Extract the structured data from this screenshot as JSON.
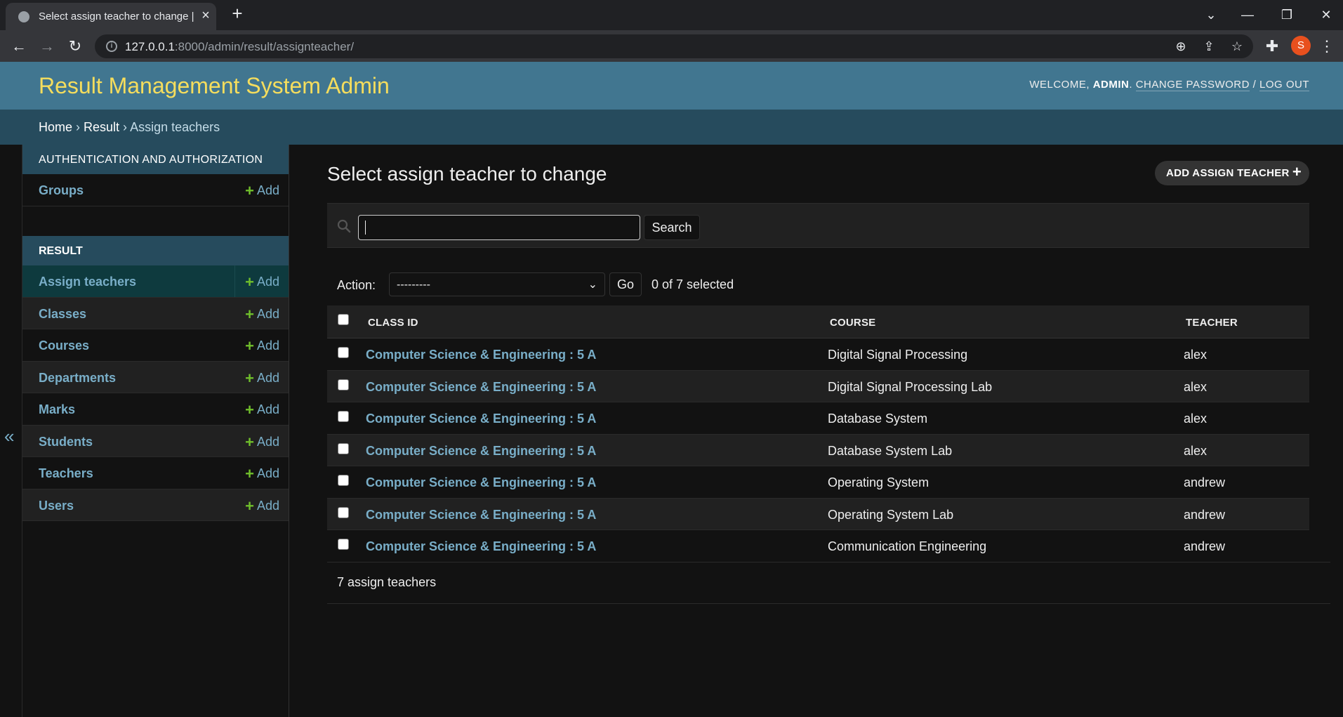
{
  "browser": {
    "tab_title": "Select assign teacher to change |",
    "tab_close": "×",
    "new_tab": "+",
    "url_host": "127.0.0.1",
    "url_path": ":8000/admin/result/assignteacher/",
    "profile_initial": "S",
    "window_controls": {
      "dropdown": "⌄",
      "minimize": "—",
      "restore": "❐",
      "close": "✕"
    },
    "nav": {
      "back": "←",
      "forward": "→",
      "reload": "↻"
    },
    "omni_icons": {
      "zoom": "⊕",
      "share": "⇪",
      "bookmark": "☆",
      "extensions": "✚",
      "menu": "⋮"
    }
  },
  "header": {
    "site_title": "Result Management System Admin",
    "welcome": "WELCOME,",
    "username": "ADMIN",
    "change_password": "CHANGE PASSWORD",
    "separator": "/",
    "logout": "LOG OUT"
  },
  "breadcrumbs": {
    "home": "Home",
    "sep": " › ",
    "app": "Result",
    "current": "Assign teachers"
  },
  "sidebar": {
    "collapse_glyph": "«",
    "auth_caption": "AUTHENTICATION AND AUTHORIZATION",
    "auth_items": [
      {
        "label": "Groups",
        "add": "Add"
      }
    ],
    "result_caption": "RESULT",
    "result_items": [
      {
        "label": "Assign teachers",
        "add": "Add"
      },
      {
        "label": "Classes",
        "add": "Add"
      },
      {
        "label": "Courses",
        "add": "Add"
      },
      {
        "label": "Departments",
        "add": "Add"
      },
      {
        "label": "Marks",
        "add": "Add"
      },
      {
        "label": "Students",
        "add": "Add"
      },
      {
        "label": "Teachers",
        "add": "Add"
      },
      {
        "label": "Users",
        "add": "Add"
      }
    ],
    "plus": "+"
  },
  "content": {
    "title": "Select assign teacher to change",
    "add_button": "ADD ASSIGN TEACHER",
    "add_plus": "+",
    "search_value": "",
    "search_button": "Search",
    "action_label": "Action:",
    "action_selected": "---------",
    "go_button": "Go",
    "counter": "0 of 7 selected",
    "columns": [
      "CLASS ID",
      "COURSE",
      "TEACHER"
    ],
    "rows": [
      {
        "class_id": "Computer Science & Engineering : 5 A",
        "course": "Digital Signal Processing",
        "teacher": "alex"
      },
      {
        "class_id": "Computer Science & Engineering : 5 A",
        "course": "Digital Signal Processing Lab",
        "teacher": "alex"
      },
      {
        "class_id": "Computer Science & Engineering : 5 A",
        "course": "Database System",
        "teacher": "alex"
      },
      {
        "class_id": "Computer Science & Engineering : 5 A",
        "course": "Database System Lab",
        "teacher": "alex"
      },
      {
        "class_id": "Computer Science & Engineering : 5 A",
        "course": "Operating System",
        "teacher": "andrew"
      },
      {
        "class_id": "Computer Science & Engineering : 5 A",
        "course": "Operating System Lab",
        "teacher": "andrew"
      },
      {
        "class_id": "Computer Science & Engineering : 5 A",
        "course": "Communication Engineering",
        "teacher": "andrew"
      }
    ],
    "paginator": "7 assign teachers"
  },
  "colors": {
    "header_bg": "#417690",
    "breadcrumb_bg": "#264b5d",
    "title_yellow": "#f5dd5d",
    "link_blue": "#79aec8",
    "add_green": "#70bf2b",
    "page_bg": "#121212"
  },
  "icons": {
    "tab_favicon": "globe-icon",
    "search": "search-icon",
    "select_chevron": "chevron-down-icon",
    "collapse": "double-chevron-left-icon"
  }
}
